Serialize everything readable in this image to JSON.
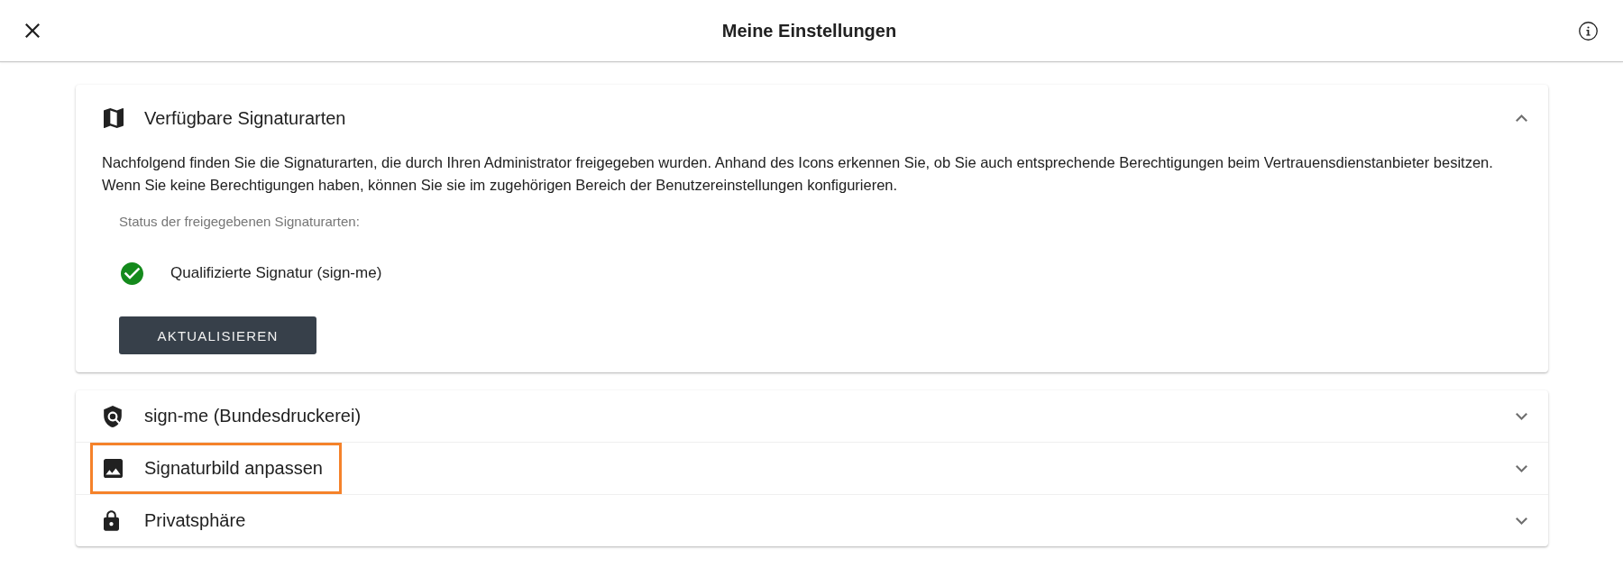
{
  "header": {
    "title": "Meine Einstellungen"
  },
  "signature_types": {
    "title": "Verfügbare Signaturarten",
    "expanded": true,
    "description": "Nachfolgend finden Sie die Signaturarten, die durch Ihren Administrator freigegeben wurden. Anhand des Icons erkennen Sie, ob Sie auch entsprechende Berechtigungen beim Vertrauensdienstanbieter besitzen. Wenn Sie keine Berechtigungen haben, können Sie sie im zugehörigen Bereich der Benutzereinstellungen konfigurieren.",
    "status_label": "Status der freigegebenen Signaturarten:",
    "statuses": [
      {
        "label": "Qualifizierte Signatur (sign-me)",
        "ok": true
      }
    ],
    "button": "AKTUALISIEREN"
  },
  "sections": [
    {
      "title": "sign-me (Bundesdruckerei)",
      "expanded": false,
      "highlighted": false
    },
    {
      "title": "Signaturbild anpassen",
      "expanded": false,
      "highlighted": true
    },
    {
      "title": "Privatsphäre",
      "expanded": false,
      "highlighted": false
    }
  ]
}
